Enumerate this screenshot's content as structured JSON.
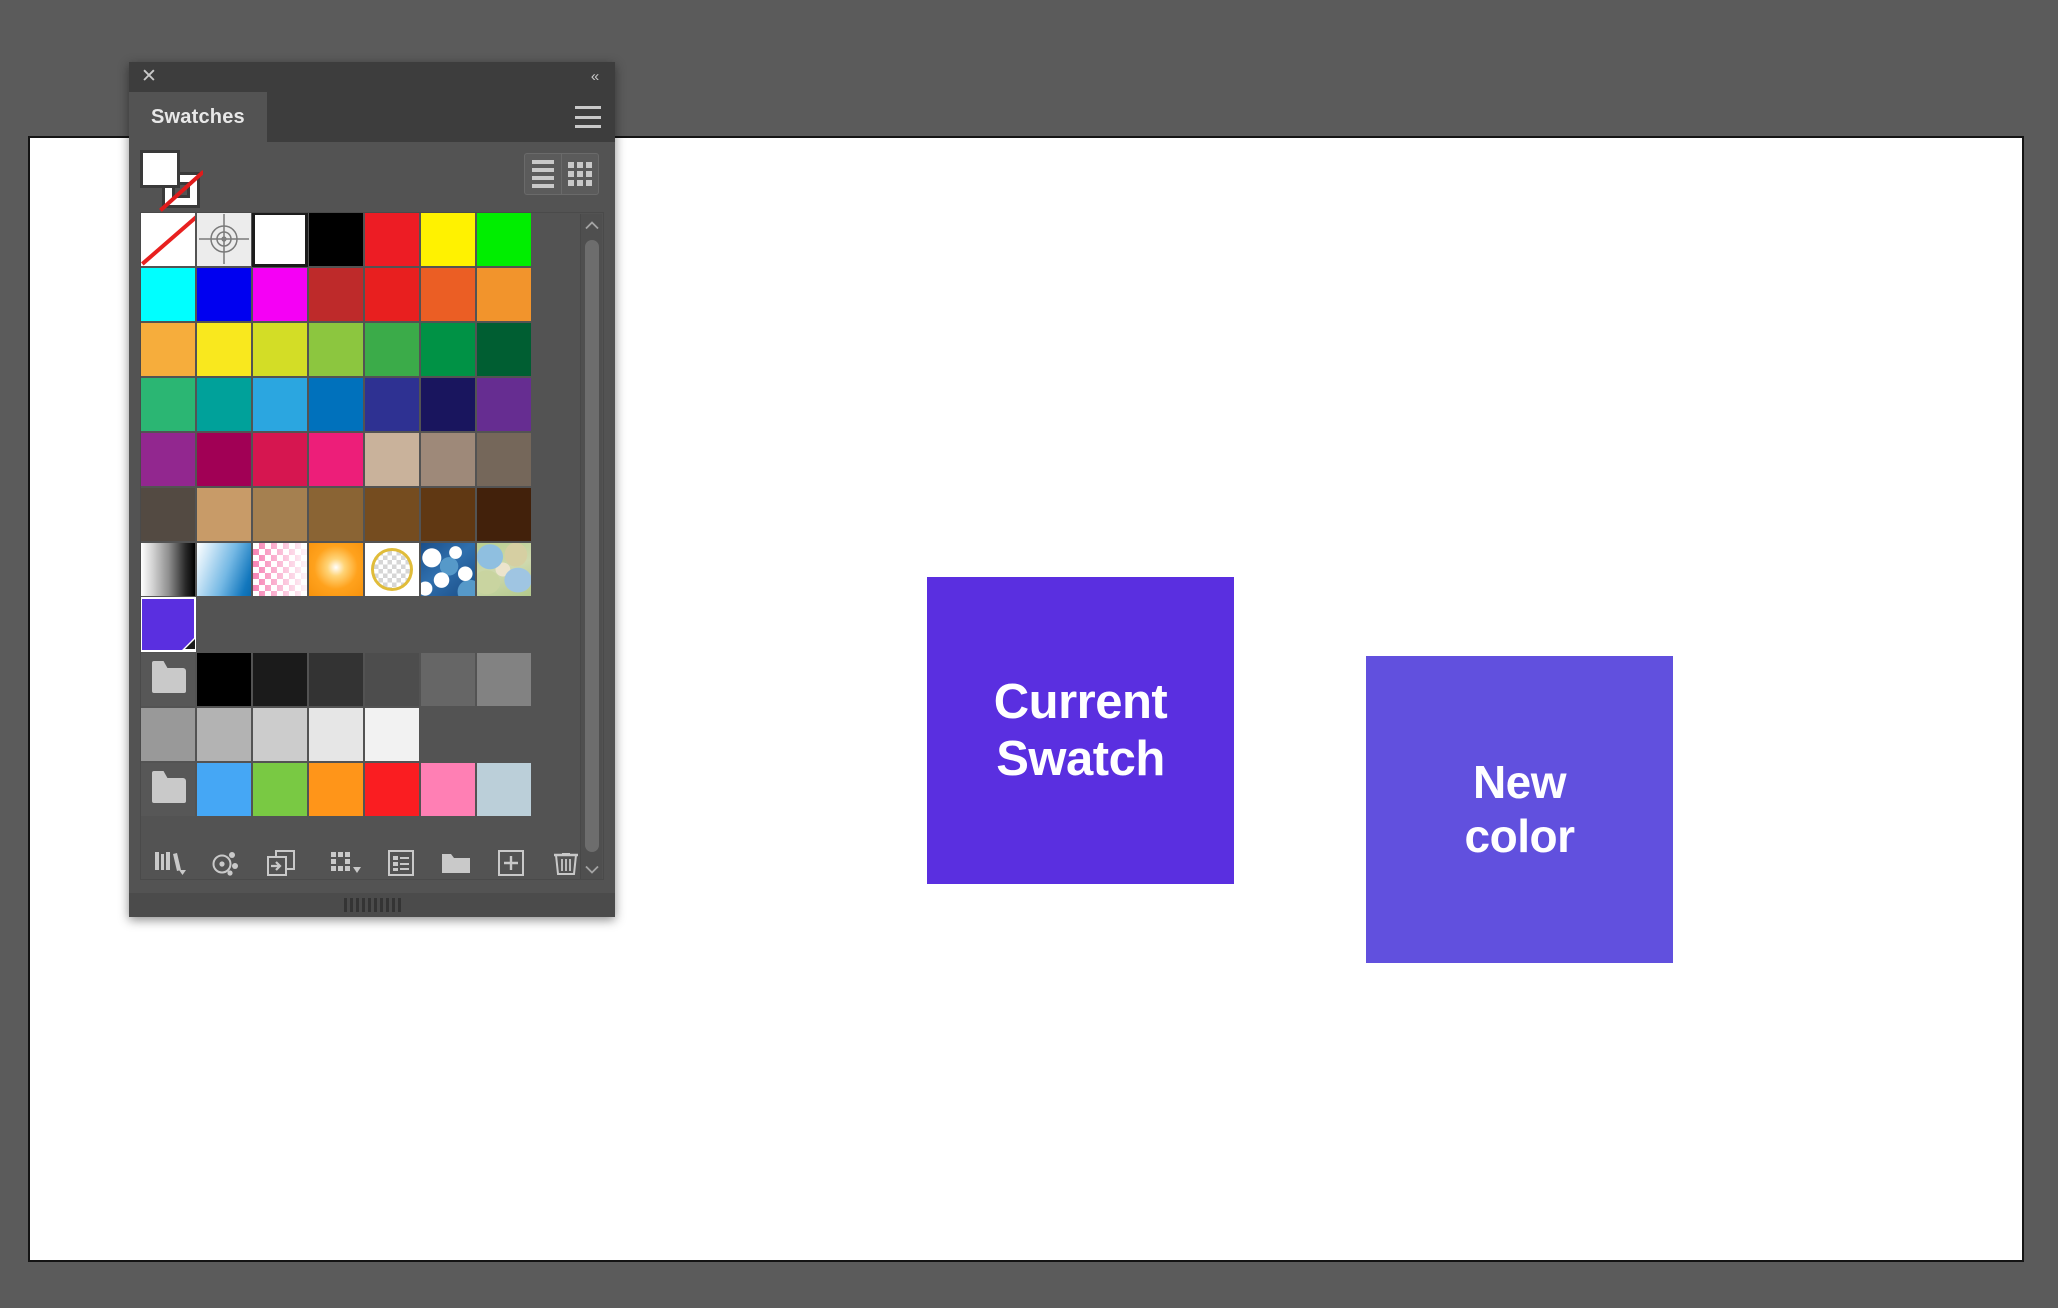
{
  "app": {
    "background_color": "#5b5b5b"
  },
  "canvas": {
    "background_color": "#ffffff",
    "border_color": "#141414",
    "objects": [
      {
        "name": "current-swatch-box",
        "label": "Current\nSwatch",
        "fill": "#5A2FE0"
      },
      {
        "name": "new-color-box",
        "label": "New\ncolor",
        "fill": "#6150DE"
      }
    ]
  },
  "panel": {
    "title": "Swatches",
    "close_label": "✕",
    "collapse_label": "«",
    "menu_label": "panel-menu-icon",
    "fill_stroke": {
      "fill_color": "#ffffff",
      "stroke_color": "none"
    },
    "view_toggles": [
      {
        "name": "list-view-toggle",
        "label": "List View",
        "active": false
      },
      {
        "name": "grid-view-toggle",
        "label": "Grid View",
        "active": true
      }
    ],
    "scrollbar": {
      "up_label": "scroll-up",
      "down_label": "scroll-down"
    },
    "toolbar": [
      {
        "name": "swatch-libraries-button",
        "label": "Swatch Libraries menu",
        "icon": "books-icon",
        "has_arrow": true
      },
      {
        "name": "color-groups-button",
        "label": "Show Color Group",
        "icon": "color-group-icon",
        "has_arrow": false
      },
      {
        "name": "add-to-library-button",
        "label": "Add selected to my library",
        "icon": "add-to-library-icon",
        "has_arrow": false
      },
      {
        "name": "show-swatch-kinds-button",
        "label": "Show Swatch Kinds menu",
        "icon": "swatch-kinds-icon",
        "has_arrow": true
      },
      {
        "name": "swatch-options-button",
        "label": "Swatch Options",
        "icon": "options-icon",
        "has_arrow": false
      },
      {
        "name": "new-color-group-button",
        "label": "New Color Group",
        "icon": "folder-icon",
        "has_arrow": false
      },
      {
        "name": "new-swatch-button",
        "label": "New Swatch",
        "icon": "plus-box-icon",
        "has_arrow": false
      },
      {
        "name": "delete-swatch-button",
        "label": "Delete Swatch",
        "icon": "trash-icon",
        "has_arrow": false
      }
    ],
    "swatch_rows": [
      [
        {
          "kind": "none",
          "name": "None"
        },
        {
          "kind": "registration",
          "name": "Registration"
        },
        {
          "kind": "color",
          "color": "#ffffff",
          "name": "White",
          "border": "#1b1b1b"
        },
        {
          "kind": "color",
          "color": "#000000",
          "name": "Black"
        },
        {
          "kind": "color",
          "color": "#ed1c24",
          "name": "Red"
        },
        {
          "kind": "color",
          "color": "#fff200",
          "name": "Yellow"
        },
        {
          "kind": "color",
          "color": "#00ee00",
          "name": "Green"
        }
      ],
      [
        {
          "kind": "color",
          "color": "#00ffff",
          "name": "Cyan"
        },
        {
          "kind": "color",
          "color": "#0000f0",
          "name": "Blue"
        },
        {
          "kind": "color",
          "color": "#f500f5",
          "name": "Magenta"
        },
        {
          "kind": "color",
          "color": "#be2a2a",
          "name": "CMYK Dark Red"
        },
        {
          "kind": "color",
          "color": "#e81f1f",
          "name": "CMYK Red"
        },
        {
          "kind": "color",
          "color": "#eb5e24",
          "name": "CMYK Orange Red"
        },
        {
          "kind": "color",
          "color": "#f2942c",
          "name": "CMYK Orange"
        }
      ],
      [
        {
          "kind": "color",
          "color": "#f6ad3c",
          "name": "CMYK Light Orange"
        },
        {
          "kind": "color",
          "color": "#f9e81e",
          "name": "CMYK Yellow"
        },
        {
          "kind": "color",
          "color": "#d3dd26",
          "name": "CMYK Yellow Green"
        },
        {
          "kind": "color",
          "color": "#8cc63f",
          "name": "CMYK Light Green"
        },
        {
          "kind": "color",
          "color": "#3bab49",
          "name": "CMYK Green"
        },
        {
          "kind": "color",
          "color": "#009245",
          "name": "CMYK Dark Green"
        },
        {
          "kind": "color",
          "color": "#005e32",
          "name": "CMYK Forest Green"
        }
      ],
      [
        {
          "kind": "color",
          "color": "#2bb673",
          "name": "CMYK Sea Green"
        },
        {
          "kind": "color",
          "color": "#00a19a",
          "name": "CMYK Teal"
        },
        {
          "kind": "color",
          "color": "#2ba6e0",
          "name": "CMYK Sky Blue"
        },
        {
          "kind": "color",
          "color": "#0071bc",
          "name": "CMYK Blue"
        },
        {
          "kind": "color",
          "color": "#2e3192",
          "name": "CMYK Dark Blue"
        },
        {
          "kind": "color",
          "color": "#19155e",
          "name": "CMYK Navy"
        },
        {
          "kind": "color",
          "color": "#662d91",
          "name": "CMYK Violet"
        }
      ],
      [
        {
          "kind": "color",
          "color": "#92278f",
          "name": "CMYK Purple"
        },
        {
          "kind": "color",
          "color": "#a10055",
          "name": "CMYK Dark Magenta"
        },
        {
          "kind": "color",
          "color": "#d61650",
          "name": "CMYK Crimson"
        },
        {
          "kind": "color",
          "color": "#ed1e79",
          "name": "CMYK Pink"
        },
        {
          "kind": "color",
          "color": "#c9b29b",
          "name": "CMYK Tan"
        },
        {
          "kind": "color",
          "color": "#9e8979",
          "name": "CMYK Warm Gray"
        },
        {
          "kind": "color",
          "color": "#75675a",
          "name": "CMYK Taupe"
        }
      ],
      [
        {
          "kind": "color",
          "color": "#534a42",
          "name": "CMYK Dark Taupe"
        },
        {
          "kind": "color",
          "color": "#c89b68",
          "name": "CMYK Light Brown"
        },
        {
          "kind": "color",
          "color": "#a58050",
          "name": "CMYK Camel"
        },
        {
          "kind": "color",
          "color": "#8a6434",
          "name": "CMYK Brown"
        },
        {
          "kind": "color",
          "color": "#754c1f",
          "name": "CMYK Dark Brown"
        },
        {
          "kind": "color",
          "color": "#603813",
          "name": "CMYK Chocolate"
        },
        {
          "kind": "color",
          "color": "#42210b",
          "name": "CMYK Espresso"
        }
      ],
      [
        {
          "kind": "gradient",
          "style": "gray",
          "name": "White, Black"
        },
        {
          "kind": "gradient",
          "style": "blue",
          "name": "White, Blue"
        },
        {
          "kind": "pattern",
          "style": "pink-check",
          "name": "Pink Check"
        },
        {
          "kind": "gradient",
          "style": "radial",
          "name": "Radial Orange"
        },
        {
          "kind": "pattern",
          "style": "circle",
          "name": "Circle Outline"
        },
        {
          "kind": "pattern",
          "style": "blue-swirl",
          "name": "Blue Swirl"
        },
        {
          "kind": "pattern",
          "style": "green-organic",
          "name": "Organic Shapes"
        }
      ],
      [
        {
          "kind": "color",
          "color": "#5A2FE0",
          "name": "Current Swatch",
          "global": true,
          "selected": true
        },
        {
          "kind": "empty"
        },
        {
          "kind": "empty"
        },
        {
          "kind": "empty"
        },
        {
          "kind": "empty"
        },
        {
          "kind": "empty"
        },
        {
          "kind": "empty"
        }
      ],
      [
        {
          "kind": "folder",
          "name": "Grayscale Group"
        },
        {
          "kind": "color",
          "color": "#000000",
          "name": "Black"
        },
        {
          "kind": "color",
          "color": "#1b1b1b",
          "name": "Gray 90"
        },
        {
          "kind": "color",
          "color": "#333333",
          "name": "Gray 80"
        },
        {
          "kind": "color",
          "color": "#4d4d4d",
          "name": "Gray 70"
        },
        {
          "kind": "color",
          "color": "#666666",
          "name": "Gray 60"
        },
        {
          "kind": "color",
          "color": "#828282",
          "name": "Gray 50"
        }
      ],
      [
        {
          "kind": "color",
          "color": "#999999",
          "name": "Gray 40"
        },
        {
          "kind": "color",
          "color": "#b3b3b3",
          "name": "Gray 30"
        },
        {
          "kind": "color",
          "color": "#cccccc",
          "name": "Gray 20"
        },
        {
          "kind": "color",
          "color": "#e6e6e6",
          "name": "Gray 10"
        },
        {
          "kind": "color",
          "color": "#f2f2f2",
          "name": "Gray 5"
        },
        {
          "kind": "empty"
        },
        {
          "kind": "empty"
        }
      ],
      [
        {
          "kind": "folder",
          "name": "Bright Group"
        },
        {
          "kind": "color",
          "color": "#45a7f5",
          "name": "Bright Blue"
        },
        {
          "kind": "color",
          "color": "#79c943",
          "name": "Bright Green"
        },
        {
          "kind": "color",
          "color": "#ff9519",
          "name": "Bright Orange"
        },
        {
          "kind": "color",
          "color": "#fa1d21",
          "name": "Bright Red"
        },
        {
          "kind": "color",
          "color": "#ff7fb4",
          "name": "Bright Pink"
        },
        {
          "kind": "color",
          "color": "#bbcfd9",
          "name": "Pale Blue"
        }
      ]
    ]
  }
}
